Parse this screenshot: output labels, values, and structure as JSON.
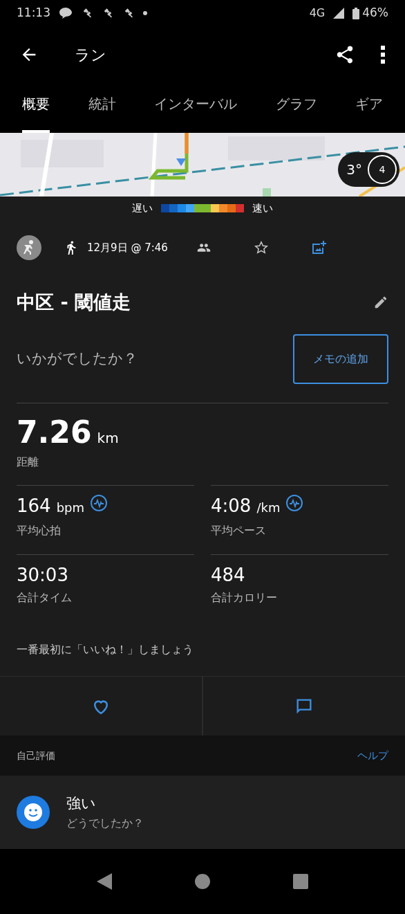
{
  "status_bar": {
    "time": "11:13",
    "network": "4G",
    "battery": "46%"
  },
  "toolbar": {
    "title": "ラン"
  },
  "tabs": [
    {
      "label": "概要",
      "selected": true
    },
    {
      "label": "統計",
      "selected": false
    },
    {
      "label": "インターバル",
      "selected": false
    },
    {
      "label": "グラフ",
      "selected": false
    },
    {
      "label": "ギア",
      "selected": false
    }
  ],
  "map": {
    "weather": {
      "temperature": "3°",
      "wind": "4"
    }
  },
  "pace_legend": {
    "slow": "遅い",
    "fast": "速い"
  },
  "activity": {
    "date": "12月9日 @ 7:46",
    "title": "中区 - 閾値走",
    "feedback_prompt": "いかがでしたか？",
    "memo_button": "メモの追加"
  },
  "distance": {
    "value": "7.26",
    "unit": "km",
    "label": "距離"
  },
  "stats": [
    {
      "value": "164",
      "unit": "bpm",
      "label": "平均心拍",
      "kind": "chart"
    },
    {
      "value": "4:08",
      "unit": "/km",
      "label": "平均ペース",
      "kind": "chart"
    },
    {
      "value": "30:03",
      "label": "合計タイム",
      "kind": "plain"
    },
    {
      "value": "484",
      "label": "合計カロリー",
      "kind": "plain"
    }
  ],
  "like_prompt": "一番最初に「いいね！」しましょう",
  "self_evaluation": {
    "header": "自己評価",
    "help": "ヘルプ",
    "level": "強い",
    "question": "どうでしたか？"
  }
}
